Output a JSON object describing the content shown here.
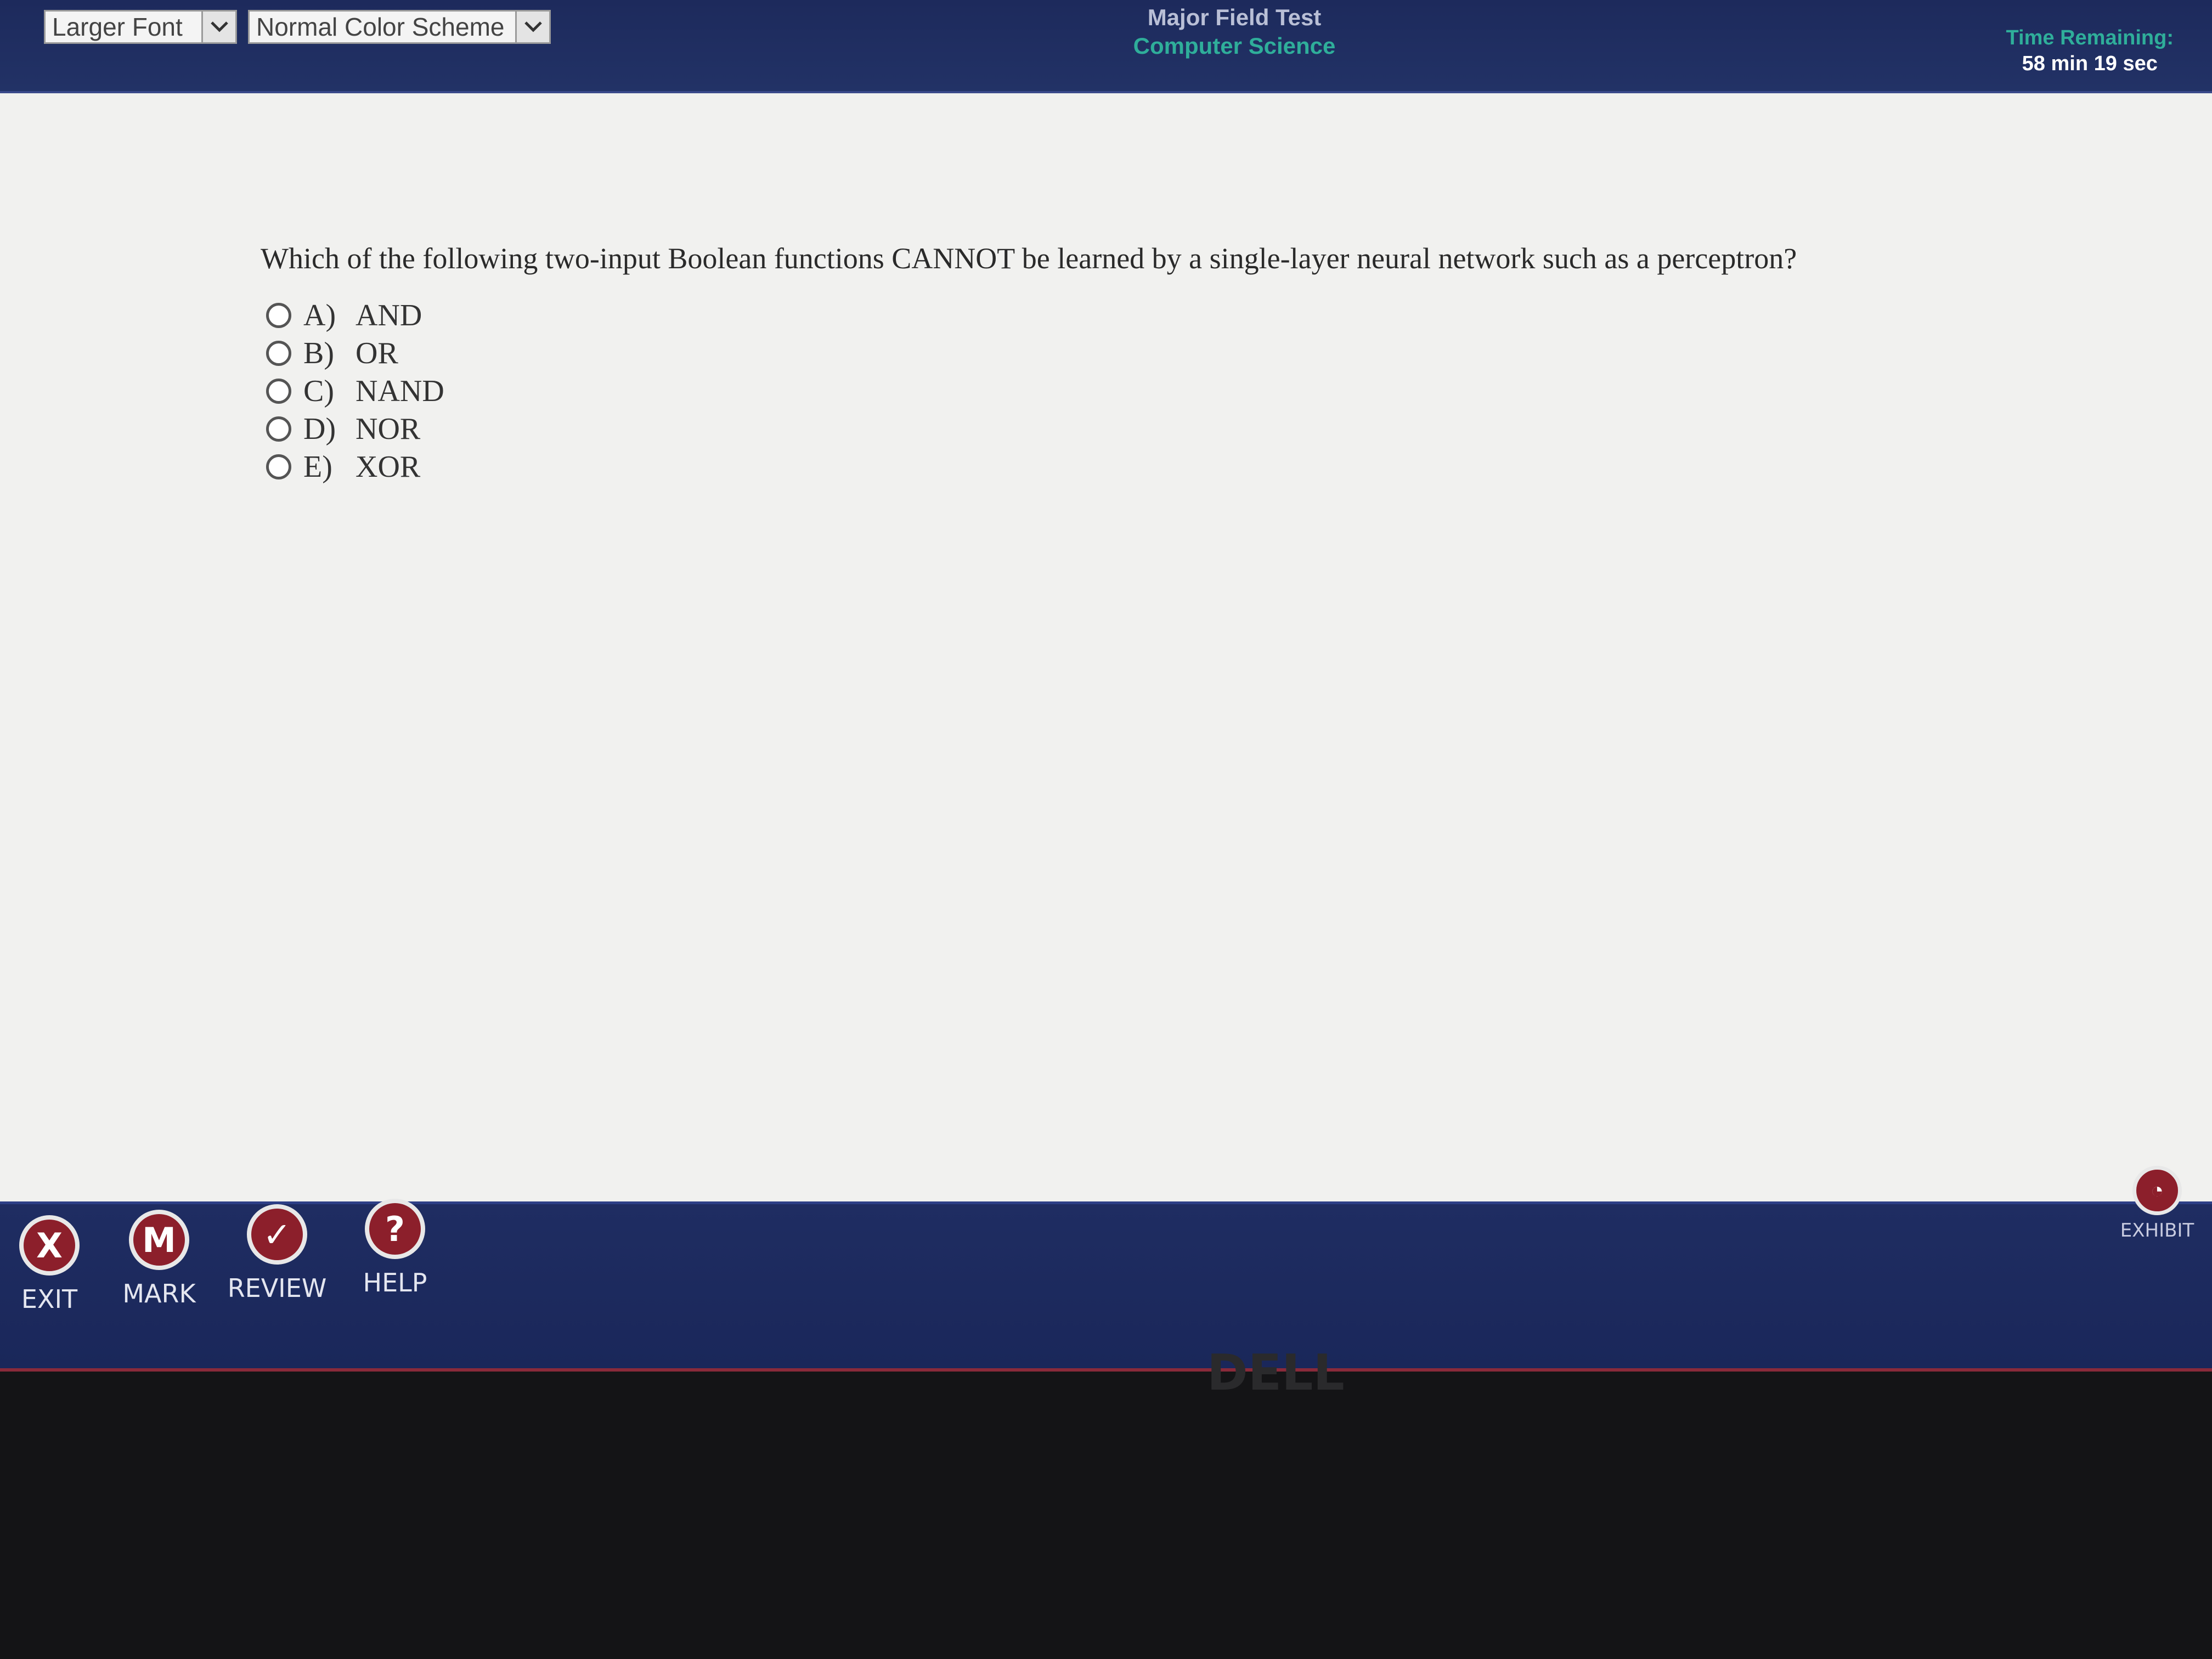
{
  "header": {
    "font_select": "Larger Font",
    "color_select": "Normal Color Scheme",
    "test_name": "Major Field Test",
    "subject": "Computer Science",
    "timer_label": "Time Remaining:",
    "timer_value": "58 min 19 sec"
  },
  "question": {
    "text": "Which of the following two-input Boolean functions CANNOT be learned by a single-layer neural network such as a perceptron?",
    "options": [
      {
        "letter": "A)",
        "text": "AND"
      },
      {
        "letter": "B)",
        "text": "OR"
      },
      {
        "letter": "C)",
        "text": "NAND"
      },
      {
        "letter": "D)",
        "text": "NOR"
      },
      {
        "letter": "E)",
        "text": "XOR"
      }
    ]
  },
  "toolbar": {
    "exit": {
      "label": "EXIT",
      "glyph": "X",
      "icon": "close-icon"
    },
    "mark": {
      "label": "MARK",
      "glyph": "M",
      "icon": "mark-icon"
    },
    "review": {
      "label": "REVIEW",
      "glyph": "✓",
      "icon": "check-icon"
    },
    "help": {
      "label": "HELP",
      "glyph": "?",
      "icon": "help-icon"
    },
    "exhibit": {
      "label": "EXHIBIT",
      "glyph": "◔",
      "icon": "exhibit-icon"
    }
  },
  "bezel": {
    "brand": "DELL"
  },
  "colors": {
    "header_bg": "#1d2a5c",
    "accent_teal": "#2fae9a",
    "button_red": "#8c1f2b",
    "page_bg": "#f1f1ef"
  }
}
